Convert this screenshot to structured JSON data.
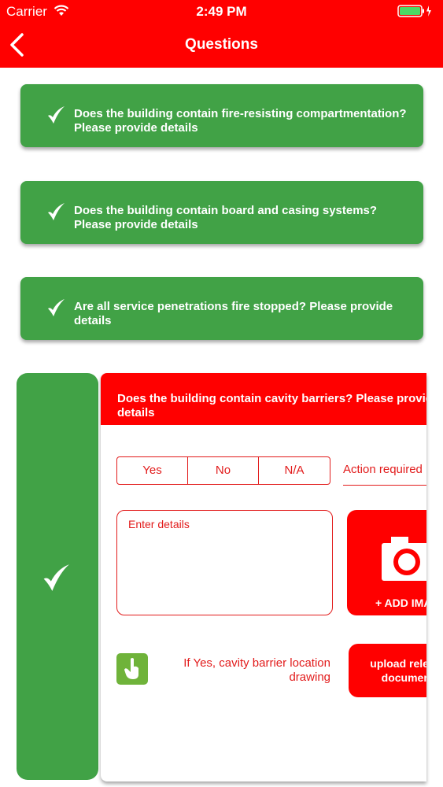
{
  "status_bar": {
    "carrier": "Carrier",
    "time": "2:49 PM"
  },
  "nav": {
    "title": "Questions"
  },
  "completed_questions": [
    {
      "text": "Does the building contain fire-resisting compartmentation? Please provide details"
    },
    {
      "text": "Does the building contain board and casing systems? Please provide details"
    },
    {
      "text": "Are all service penetrations fire stopped? Please provide details"
    }
  ],
  "active_question": {
    "text": "Does the building contain cavity barriers? Please provide details",
    "options": [
      "Yes",
      "No",
      "N/A"
    ],
    "action_label": "Action required",
    "details_placeholder": "Enter details",
    "add_image_label": "+ ADD IMAGE",
    "note": "If Yes, cavity barrier location drawing",
    "upload_label": "upload relevant documents"
  },
  "colors": {
    "brand_red": "#ff0000",
    "accent_green": "#41a246"
  }
}
